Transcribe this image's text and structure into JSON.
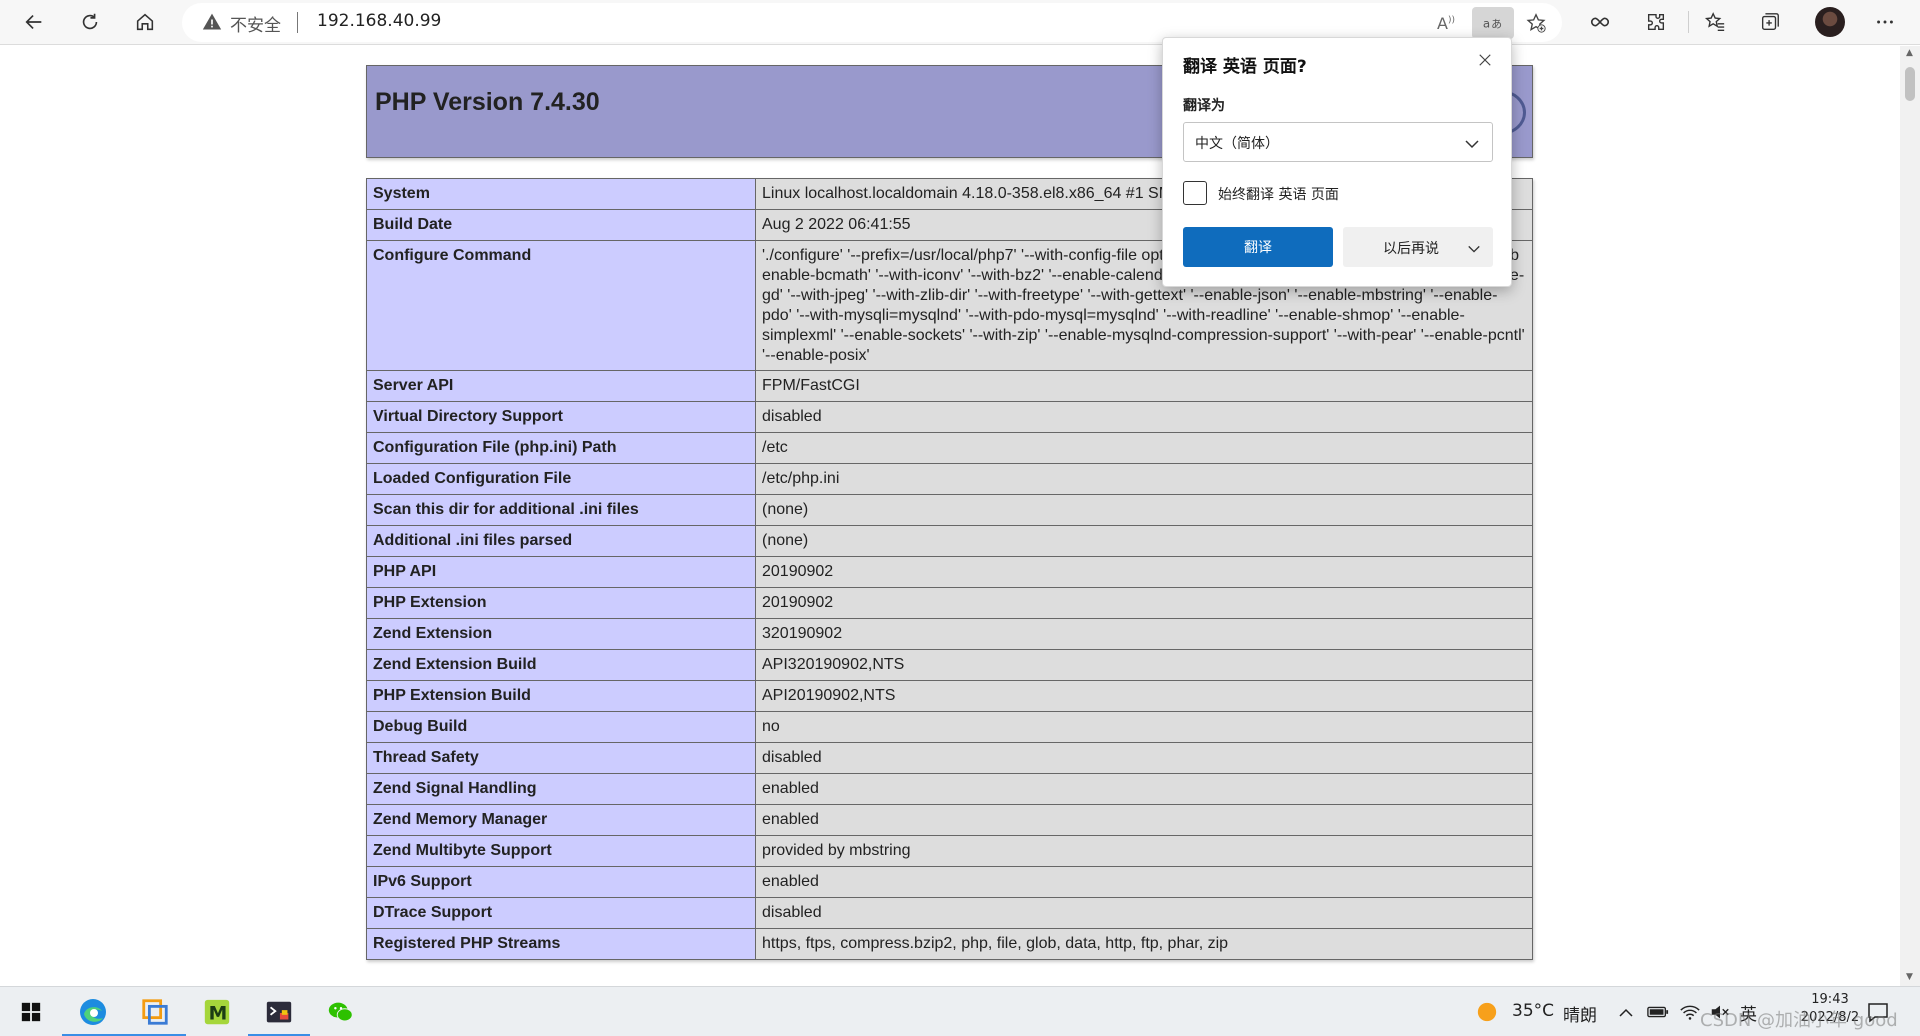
{
  "browser": {
    "security_label": "不安全",
    "url": "192.168.40.99",
    "icons": [
      "back-icon",
      "refresh-icon",
      "home-icon",
      "warning-icon",
      "read-aloud-icon",
      "translate-icon",
      "add-favorite-icon",
      "infinity-icon",
      "extensions-icon",
      "favorites-icon",
      "collections-icon",
      "profile-avatar",
      "more-icon"
    ]
  },
  "page": {
    "title": "PHP Version 7.4.30",
    "rows": [
      {
        "key": "System",
        "value": "Linux localhost.localdomain 4.18.0-358.el8.x86_64 #1 SM"
      },
      {
        "key": "Build Date",
        "value": "Aug 2 2022 06:41:55"
      },
      {
        "key": "Configure Command",
        "value": "'./configure' '--prefix=/usr/local/php7' '--with-config-file optimization' '--disable-debug' '--disable-rpath' '--enab enable-bcmath' '--with-iconv' '--with-bz2' '--enable-calendar' '--with-curl' '--enable-exif' '--enable-ftp' '--enable-gd' '--with-jpeg' '--with-zlib-dir' '--with-freetype' '--with-gettext' '--enable-json' '--enable-mbstring' '--enable-pdo' '--with-mysqli=mysqlnd' '--with-pdo-mysql=mysqlnd' '--with-readline' '--enable-shmop' '--enable-simplexml' '--enable-sockets' '--with-zip' '--enable-mysqlnd-compression-support' '--with-pear' '--enable-pcntl' '--enable-posix'"
      },
      {
        "key": "Server API",
        "value": "FPM/FastCGI"
      },
      {
        "key": "Virtual Directory Support",
        "value": "disabled"
      },
      {
        "key": "Configuration File (php.ini) Path",
        "value": "/etc"
      },
      {
        "key": "Loaded Configuration File",
        "value": "/etc/php.ini"
      },
      {
        "key": "Scan this dir for additional .ini files",
        "value": "(none)"
      },
      {
        "key": "Additional .ini files parsed",
        "value": "(none)"
      },
      {
        "key": "PHP API",
        "value": "20190902"
      },
      {
        "key": "PHP Extension",
        "value": "20190902"
      },
      {
        "key": "Zend Extension",
        "value": "320190902"
      },
      {
        "key": "Zend Extension Build",
        "value": "API320190902,NTS"
      },
      {
        "key": "PHP Extension Build",
        "value": "API20190902,NTS"
      },
      {
        "key": "Debug Build",
        "value": "no"
      },
      {
        "key": "Thread Safety",
        "value": "disabled"
      },
      {
        "key": "Zend Signal Handling",
        "value": "enabled"
      },
      {
        "key": "Zend Memory Manager",
        "value": "enabled"
      },
      {
        "key": "Zend Multibyte Support",
        "value": "provided by mbstring"
      },
      {
        "key": "IPv6 Support",
        "value": "enabled"
      },
      {
        "key": "DTrace Support",
        "value": "disabled"
      },
      {
        "key": "Registered PHP Streams",
        "value": "https, ftps, compress.bzip2, php, file, glob, data, http, ftp, phar, zip"
      }
    ]
  },
  "translate_popup": {
    "title": "翻译 英语 页面?",
    "translate_to_label": "翻译为",
    "language_selected": "中文（简体）",
    "always_translate_label": "始终翻译 英语 页面",
    "translate_button": "翻译",
    "later_button": "以后再说"
  },
  "taskbar": {
    "apps": [
      "windows-start-icon",
      "edge-icon",
      "vmware-icon",
      "mobaxterm-icon",
      "terminal-app-icon",
      "wechat-icon"
    ],
    "weather_temp": "35°C",
    "weather_desc": "晴朗",
    "ime": "英",
    "time": "19:43",
    "date": "2022/8/2",
    "watermark": "CSDN @加油小年 good"
  },
  "colors": {
    "php_header": "#9999cc",
    "php_key_cell": "#ccccff",
    "php_value_cell": "#dddddd",
    "primary_button": "#0f6cbd"
  }
}
